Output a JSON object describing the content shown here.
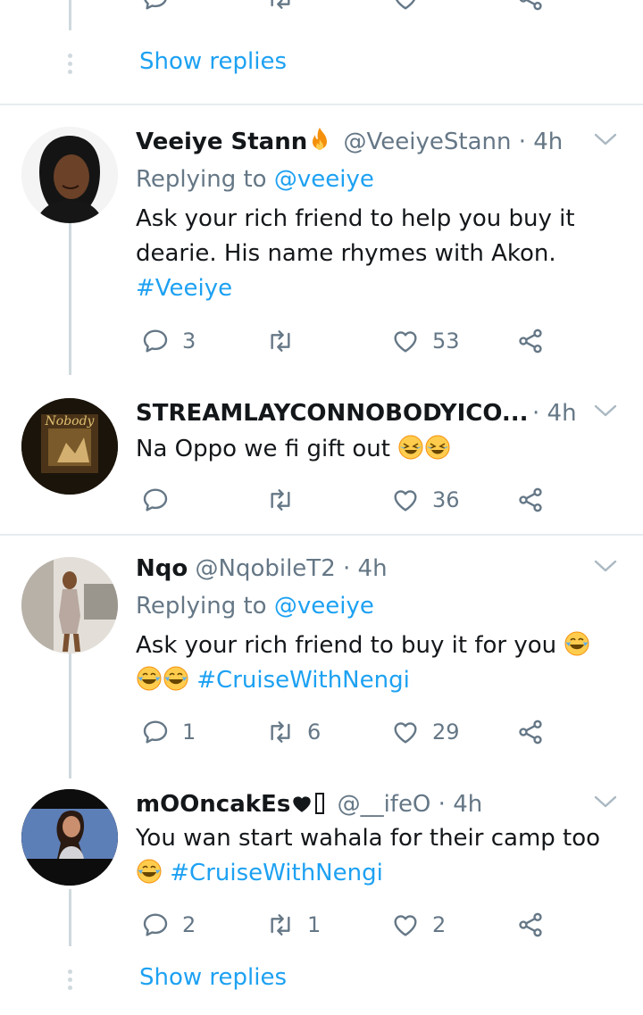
{
  "top": {
    "show_replies": "Show replies"
  },
  "tweets": [
    {
      "name": "Veeiye Stann",
      "handle": "@VeeiyeStann",
      "time": "· 4h",
      "reply_label": "Replying to",
      "reply_mention": "@veeiye",
      "text_1": "Ask your rich friend to help you buy it",
      "text_2": "dearie. His name rhymes with Akon.",
      "hashtag": "#Veeiye",
      "replies": "3",
      "retweets": "",
      "likes": "53"
    },
    {
      "name": "STREAMLAYCONNOBODYICO...",
      "handle": "",
      "time": "· 4h",
      "text_1": "Na Oppo we fi gift out",
      "avatar_text": "Nobody",
      "replies": "",
      "retweets": "",
      "likes": "36"
    },
    {
      "name": "Nqo",
      "handle": "@NqobileT2",
      "time": "· 4h",
      "reply_label": "Replying to",
      "reply_mention": "@veeiye",
      "text_1": "Ask your rich friend to buy it for you",
      "hashtag": "#CruiseWithNengi",
      "replies": "1",
      "retweets": "6",
      "likes": "29"
    },
    {
      "name": "mOOncakEs",
      "name_suffix": "🖤🖤",
      "handle": "@__ifeO",
      "time": "· 4h",
      "text_1": "You wan start wahala for their camp too",
      "hashtag": "#CruiseWithNengi",
      "replies": "2",
      "retweets": "1",
      "likes": "2"
    }
  ],
  "bottom": {
    "show_replies": "Show replies"
  },
  "colors": {
    "link": "#1da1f2",
    "muted": "#657786",
    "thread": "#cfd9de",
    "divider": "#e6ecf0"
  }
}
